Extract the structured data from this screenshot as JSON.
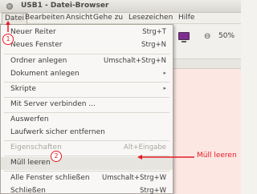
{
  "window": {
    "title": "USB1 - Datei-Browser"
  },
  "menubar": {
    "items": [
      "Datei",
      "Bearbeiten",
      "Ansicht",
      "Gehe zu",
      "Lesezeichen",
      "Hilfe"
    ]
  },
  "toolbar": {
    "zoom": "50%"
  },
  "menu": {
    "items": [
      {
        "label": "Neuer Reiter",
        "shortcut": "Strg+T"
      },
      {
        "label": "Neues Fenster",
        "shortcut": "Strg+N"
      },
      {
        "label": "Ordner anlegen",
        "shortcut": "Umschalt+Strg+N"
      },
      {
        "label": "Dokument anlegen",
        "submenu": "▸"
      },
      {
        "label": "Skripte",
        "submenu": "▸"
      },
      {
        "label": "Mit Server verbinden ..."
      },
      {
        "label": "Auswerfen"
      },
      {
        "label": "Laufwerk sicher entfernen"
      },
      {
        "label": "Eigenschaften",
        "shortcut": "Alt+Eingabe"
      },
      {
        "label": "Müll leeren"
      },
      {
        "label": "Alle Fenster schließen",
        "shortcut": "Umschalt+Strg+W"
      },
      {
        "label": "Schließen",
        "shortcut": "Strg+W"
      }
    ]
  },
  "annotations": {
    "badge_1": "1",
    "badge_2": "2",
    "arrow_label": "Müll leeren",
    "color": "#e31d26"
  }
}
